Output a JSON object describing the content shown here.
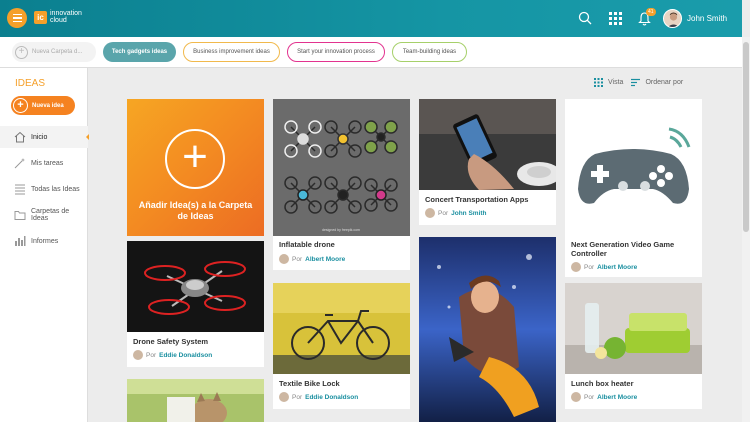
{
  "header": {
    "logo_mark": "ic",
    "logo_text": "innovation cloud",
    "notification_count": "41",
    "user_name": "John Smith"
  },
  "folder_tabs": [
    {
      "label": "Nueva Carpeta d..."
    },
    {
      "label": "Tech gadgets ideas"
    },
    {
      "label": "Business improvement ideas"
    },
    {
      "label": "Start your innovation process"
    },
    {
      "label": "Team-building ideas"
    }
  ],
  "sidebar": {
    "title": "IDEAS",
    "new_idea": "Nueva idea",
    "items": [
      {
        "label": "Inicio"
      },
      {
        "label": "Mis tareas"
      },
      {
        "label": "Todas las Ideas"
      },
      {
        "label": "Carpetas de Ideas"
      },
      {
        "label": "Informes"
      }
    ]
  },
  "view": {
    "vista": "Vista",
    "orden": "Ordenar por"
  },
  "add_card": {
    "label": "Añadir Idea(s) a la Carpeta de Ideas"
  },
  "by_prefix": "Por",
  "cards": [
    {
      "title": "Inflatable drone",
      "author": "Albert Moore"
    },
    {
      "title": "Concert Transportation Apps",
      "author": "John Smith"
    },
    {
      "title": "Next Generation Video Game Controller",
      "author": "Albert Moore"
    },
    {
      "title": "Drone Safety System",
      "author": "Eddie Donaldson"
    },
    {
      "title": "Textile Bike Lock",
      "author": "Eddie Donaldson"
    },
    {
      "title": "Lunch box heater",
      "author": "Albert Moore"
    }
  ],
  "image_watermark": "designed by freepik.com"
}
